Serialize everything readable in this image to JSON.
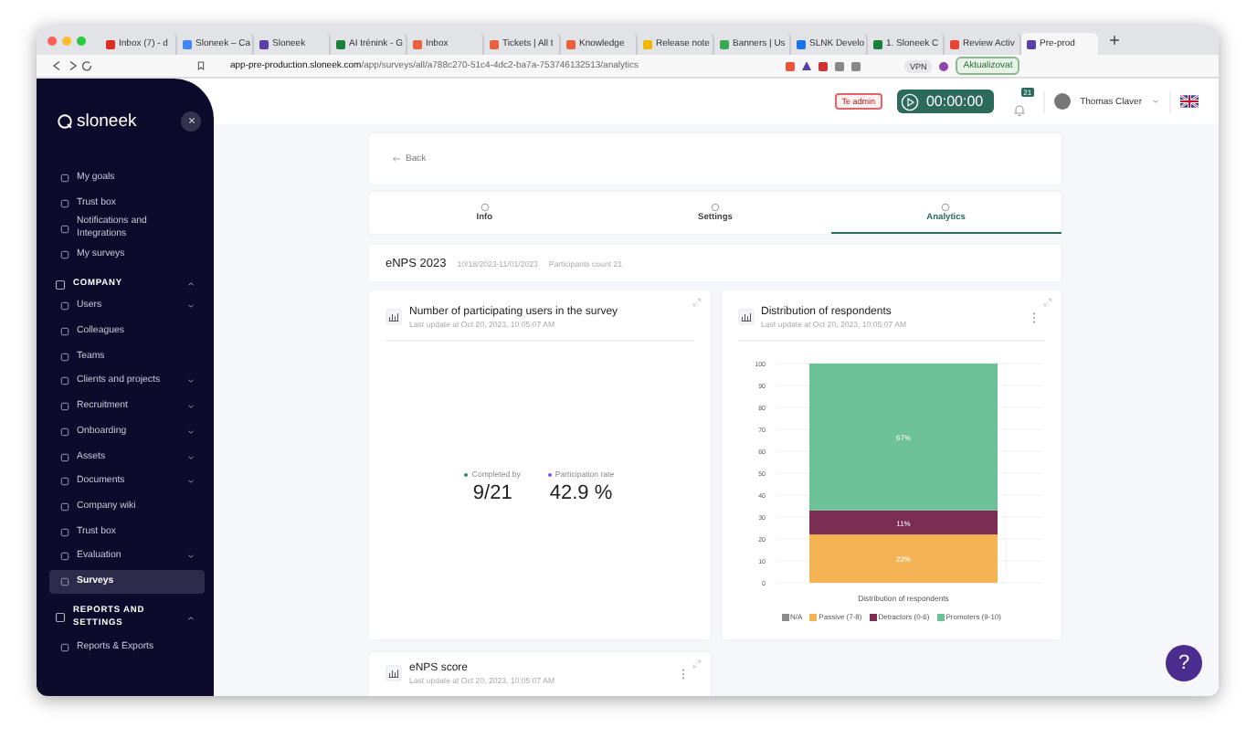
{
  "browser": {
    "tabs": [
      {
        "title": "Inbox (7) - d",
        "color": "#d93025",
        "selected": false
      },
      {
        "title": "Sloneek – Ca",
        "color": "#4285f4",
        "selected": false
      },
      {
        "title": "Sloneek",
        "color": "#5b3fa8",
        "selected": false
      },
      {
        "title": "AI trénink - G",
        "color": "#188038",
        "selected": false
      },
      {
        "title": "Inbox",
        "color": "#e8603c",
        "selected": false
      },
      {
        "title": "Tickets | All t",
        "color": "#e8603c",
        "selected": false
      },
      {
        "title": "Knowledge",
        "color": "#e8603c",
        "selected": false
      },
      {
        "title": "Release note",
        "color": "#f2b600",
        "selected": false
      },
      {
        "title": "Banners | Us",
        "color": "#34a853",
        "selected": false
      },
      {
        "title": "SLNK Develo",
        "color": "#1a73e8",
        "selected": false
      },
      {
        "title": "1. Sloneek C",
        "color": "#188038",
        "selected": false
      },
      {
        "title": "Review Activ",
        "color": "#ea4335",
        "selected": false
      },
      {
        "title": "Pre-prod",
        "color": "#5b3fa8",
        "selected": true
      }
    ],
    "url_host": "app-pre-production.sloneek.com",
    "url_path": "/app/surveys/all/a788c270-51c4-4dc2-ba7a-753746132513/analytics",
    "vpn": "VPN",
    "update_button": "Aktualizovat"
  },
  "sidebar": {
    "logo": "sloneek",
    "items": [
      {
        "kind": "link",
        "label": "My goals",
        "selected": false
      },
      {
        "kind": "link",
        "label": "Trust box",
        "selected": false
      },
      {
        "kind": "link",
        "label": "Notifications and Integrations",
        "selected": false
      },
      {
        "kind": "link",
        "label": "My surveys",
        "selected": false
      },
      {
        "kind": "section",
        "label": "COMPANY",
        "expanded": true
      },
      {
        "kind": "group",
        "label": "Users",
        "expanded": false
      },
      {
        "kind": "link",
        "label": "Colleagues",
        "selected": false
      },
      {
        "kind": "link",
        "label": "Teams",
        "selected": false
      },
      {
        "kind": "group",
        "label": "Clients and projects",
        "expanded": false
      },
      {
        "kind": "group",
        "label": "Recruitment",
        "expanded": false
      },
      {
        "kind": "group",
        "label": "Onboarding",
        "expanded": false
      },
      {
        "kind": "group",
        "label": "Assets",
        "expanded": false
      },
      {
        "kind": "group",
        "label": "Documents",
        "expanded": false
      },
      {
        "kind": "link",
        "label": "Company wiki",
        "selected": false
      },
      {
        "kind": "link",
        "label": "Trust box",
        "selected": false
      },
      {
        "kind": "group",
        "label": "Evaluation",
        "expanded": false
      },
      {
        "kind": "link",
        "label": "Surveys",
        "selected": true
      },
      {
        "kind": "section",
        "label": "REPORTS AND SETTINGS",
        "expanded": true
      },
      {
        "kind": "link",
        "label": "Reports & Exports",
        "selected": false
      }
    ]
  },
  "header": {
    "badge": "Te admin",
    "timer": "00:00:00",
    "notifications": "21",
    "user": "Thomas Claver"
  },
  "back": "Back",
  "tabs": [
    {
      "label": "Info",
      "selected": false
    },
    {
      "label": "Settings",
      "selected": false
    },
    {
      "label": "Analytics",
      "selected": true
    }
  ],
  "survey": {
    "title": "eNPS 2023",
    "dates": "10/18/2023-11/01/2023",
    "participants": "Participants count 21"
  },
  "cards": [
    {
      "kind": "stats",
      "title": "Number of participating users in the survey",
      "updated": "Last update at Oct 20, 2023, 10:05:07 AM",
      "stats": [
        {
          "label": "Completed by",
          "value": "9/21",
          "color": "#2d8a6e"
        },
        {
          "label": "Participation rate",
          "value": "42.9 %",
          "color": "#6c5ce7"
        }
      ]
    },
    {
      "kind": "chart",
      "title": "Distribution of respondents",
      "updated": "Last update at Oct 20, 2023, 10:05:07 AM",
      "chart_data": {
        "type": "bar",
        "stacked": true,
        "grid": true,
        "categories": [
          "Distribution of respondents"
        ],
        "ylim": [
          0,
          100
        ],
        "yticks": [
          0,
          10,
          20,
          30,
          40,
          50,
          60,
          70,
          80,
          90,
          100
        ],
        "series": [
          {
            "name": "N/A",
            "color": "#8c8c8c",
            "values": [
              0
            ]
          },
          {
            "name": "Passive (7-8)",
            "color": "#f5b454",
            "values": [
              22
            ]
          },
          {
            "name": "Detractors (0-6)",
            "color": "#7b2d52",
            "values": [
              11
            ]
          },
          {
            "name": "Promoters (9-10)",
            "color": "#6cc196",
            "values": [
              67
            ]
          }
        ],
        "value_labels": [
          null,
          "22%",
          "11%",
          "67%"
        ]
      }
    },
    {
      "kind": "score",
      "title": "eNPS score",
      "updated": "Last update at Oct 20, 2023, 10:05:07 AM"
    }
  ],
  "help": "?"
}
